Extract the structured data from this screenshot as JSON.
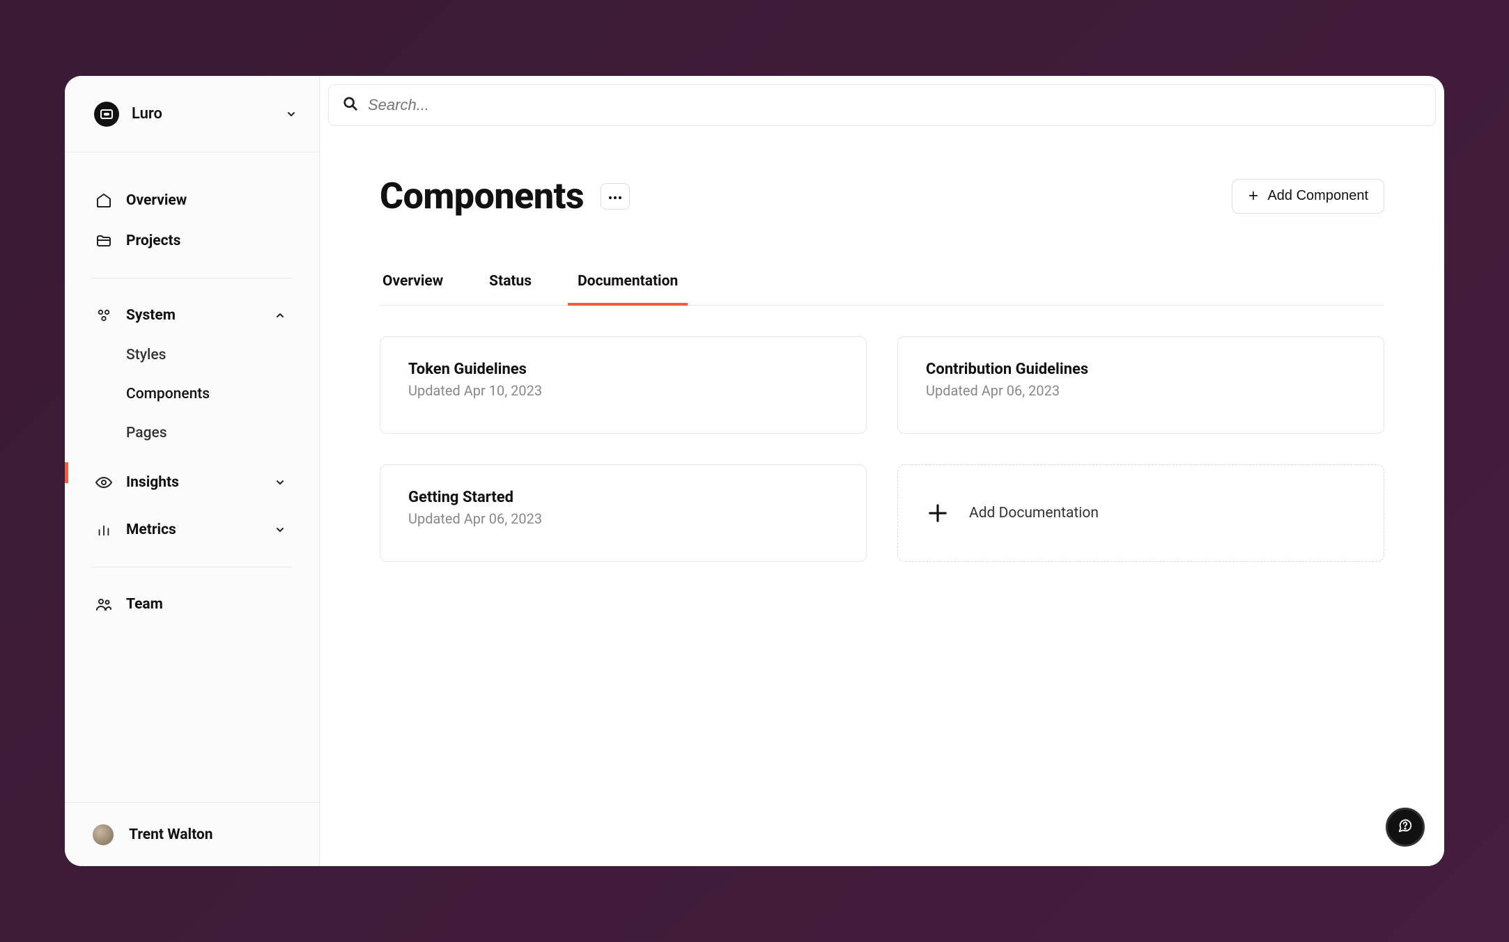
{
  "workspace": {
    "name": "Luro"
  },
  "search": {
    "placeholder": "Search..."
  },
  "sidebar": {
    "items": {
      "overview": "Overview",
      "projects": "Projects",
      "system": "System",
      "styles": "Styles",
      "components": "Components",
      "pages": "Pages",
      "insights": "Insights",
      "metrics": "Metrics",
      "team": "Team"
    }
  },
  "user": {
    "name": "Trent Walton"
  },
  "page": {
    "title": "Components",
    "add_button": "Add Component"
  },
  "tabs": {
    "overview": "Overview",
    "status": "Status",
    "documentation": "Documentation"
  },
  "docs": [
    {
      "title": "Token Guidelines",
      "updated": "Updated Apr 10, 2023"
    },
    {
      "title": "Contribution Guidelines",
      "updated": "Updated Apr 06, 2023"
    },
    {
      "title": "Getting Started",
      "updated": "Updated Apr 06, 2023"
    }
  ],
  "add_doc_label": "Add Documentation",
  "colors": {
    "accent": "#ff5a36"
  }
}
